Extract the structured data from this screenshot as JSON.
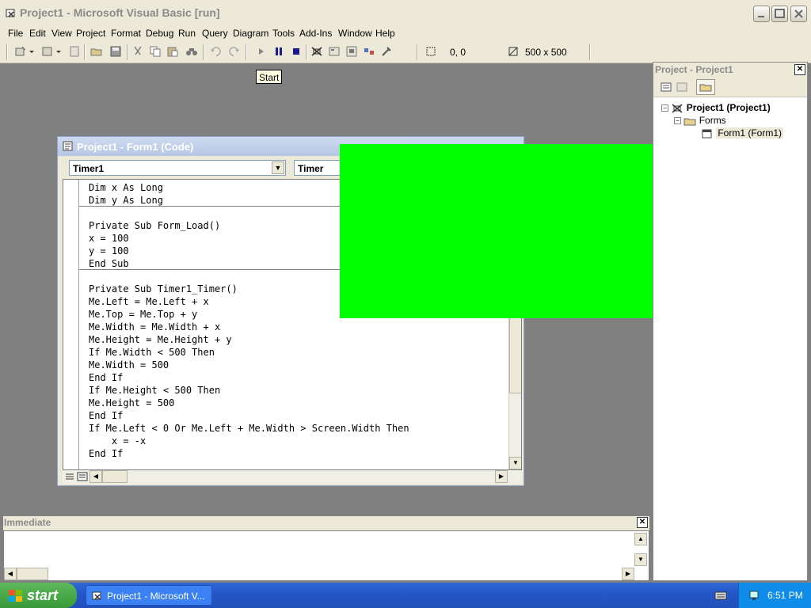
{
  "window": {
    "title": "Project1 - Microsoft Visual Basic [run]"
  },
  "menu": [
    "File",
    "Edit",
    "View",
    "Project",
    "Format",
    "Debug",
    "Run",
    "Query",
    "Diagram",
    "Tools",
    "Add-Ins",
    "Window",
    "Help"
  ],
  "toolbar": {
    "position_readout": "0, 0",
    "size_readout": "500 x 500"
  },
  "tooltip": "Start",
  "code_window": {
    "title": "Project1 - Form1 (Code)",
    "object_combo": "Timer1",
    "proc_combo": "Timer",
    "lines": [
      "Dim x As Long",
      "Dim y As Long",
      "Private Sub Form_Load()",
      "x = 100",
      "y = 100",
      "End Sub",
      "Private Sub Timer1_Timer()",
      "Me.Left = Me.Left + x",
      "Me.Top = Me.Top + y",
      "Me.Width = Me.Width + x",
      "Me.Height = Me.Height + y",
      "If Me.Width < 500 Then",
      "Me.Width = 500",
      "End If",
      "If Me.Height < 500 Then",
      "Me.Height = 500",
      "End If",
      "If Me.Left < 0 Or Me.Left + Me.Width > Screen.Width Then",
      "    x = -x",
      "End If"
    ]
  },
  "project_panel": {
    "title": "Project - Project1",
    "tree": {
      "root": "Project1 (Project1)",
      "folder": "Forms",
      "item": "Form1 (Form1)"
    }
  },
  "immediate": {
    "title": "Immediate"
  },
  "taskbar": {
    "start_label": "start",
    "task_label": "Project1 - Microsoft V...",
    "clock": "6:51 PM"
  },
  "colors": {
    "overlay_green": "#00ff00",
    "taskbar_blue": "#2457c8",
    "start_green": "#3a9d3a"
  }
}
